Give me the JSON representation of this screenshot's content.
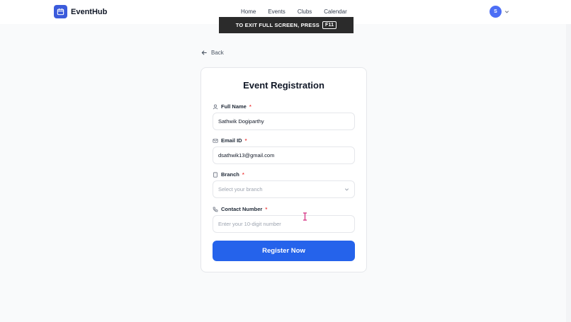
{
  "app": {
    "name": "EventHub"
  },
  "nav": {
    "items": [
      "Home",
      "Events",
      "Clubs",
      "Calendar"
    ]
  },
  "user": {
    "initial": "S"
  },
  "fullscreen_banner": {
    "text": "TO EXIT FULL SCREEN, PRESS",
    "key": "F11"
  },
  "back": {
    "label": "Back"
  },
  "form": {
    "title": "Event Registration",
    "full_name": {
      "label": "Full Name",
      "required": "*",
      "value": "Sathwik Dogiparthy"
    },
    "email": {
      "label": "Email ID",
      "required": "*",
      "value": "dsathwik13@gmail.com"
    },
    "branch": {
      "label": "Branch",
      "required": "*",
      "placeholder": "Select your branch"
    },
    "contact": {
      "label": "Contact Number",
      "required": "*",
      "placeholder": "Enter your 10-digit number"
    },
    "submit_label": "Register Now"
  },
  "icons": {
    "logo": "calendar-icon",
    "full_name": "user-icon",
    "email": "mail-icon",
    "branch": "building-icon",
    "contact": "phone-icon"
  },
  "colors": {
    "brand": "#3b5bdb",
    "primary_button": "#2563eb",
    "required": "#ef4444"
  }
}
